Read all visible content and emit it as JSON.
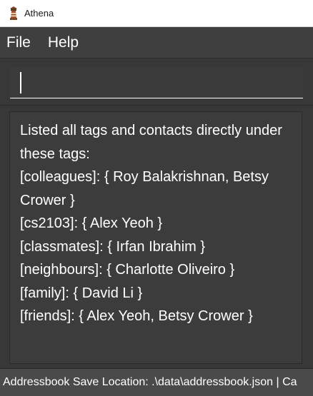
{
  "window": {
    "title": "Athena",
    "icon": "lighthouse-icon"
  },
  "menubar": {
    "file_label": "File",
    "help_label": "Help"
  },
  "command_box": {
    "value": ""
  },
  "result_display": {
    "lines": [
      "Listed all tags and contacts directly under",
      "these tags:",
      "[colleagues]: { Roy Balakrishnan, Betsy",
      "Crower }",
      "[cs2103]: { Alex Yeoh }",
      "[classmates]: { Irfan Ibrahim }",
      "[neighbours]: { Charlotte Oliveiro }",
      "[family]: { David Li }",
      "[friends]: { Alex Yeoh, Betsy Crower }"
    ]
  },
  "status_bar": {
    "text": "Addressbook Save Location: .\\data\\addressbook.json | Ca"
  },
  "colors": {
    "background": "#383838",
    "menubar": "#3f3f3f",
    "text": "#ffffff"
  }
}
